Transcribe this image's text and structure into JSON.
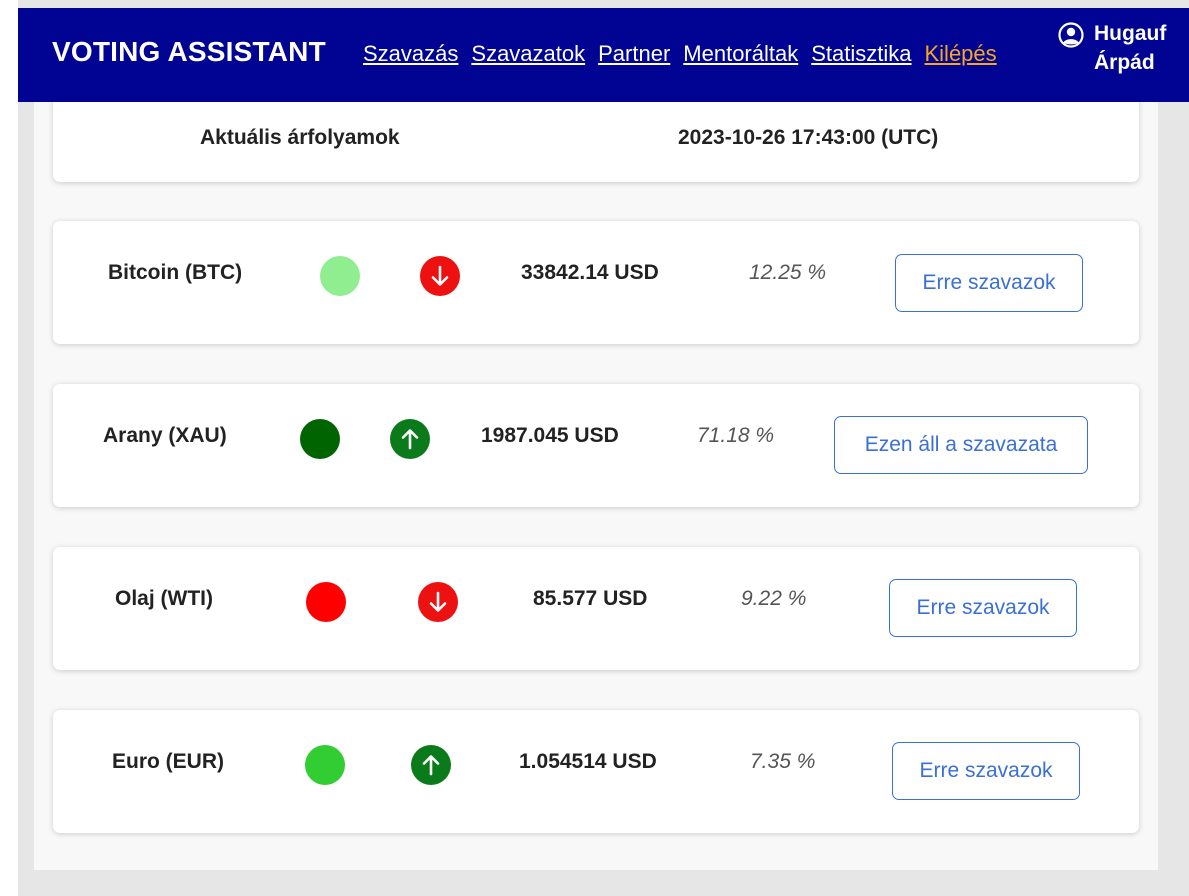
{
  "navbar": {
    "brand": "VOTING ASSISTANT",
    "links": [
      "Szavazás",
      "Szavazatok",
      "Partner",
      "Mentoráltak",
      "Statisztika",
      "Kilépés"
    ],
    "user": {
      "first": "Hugauf",
      "last": "Árpád",
      "icon": "user-circle-icon"
    },
    "colors": {
      "background": "#010493",
      "logout": "#f5a623"
    }
  },
  "rates_header": {
    "label": "Aktuális árfolyamok",
    "timestamp": "2023-10-26 17:43:00 (UTC)"
  },
  "assets": [
    {
      "name": "Bitcoin (BTC)",
      "status_color": "#90ee90",
      "trend": "down",
      "trend_icon": "arrow-down-icon",
      "trend_color": "#ee1111",
      "price": "33842.14 USD",
      "percent": "12.25 %",
      "button": "Erre szavazok"
    },
    {
      "name": "Arany (XAU)",
      "status_color": "#006400",
      "trend": "up",
      "trend_icon": "arrow-up-icon",
      "trend_color": "#0b7a1b",
      "price": "1987.045 USD",
      "percent": "71.18 %",
      "button": "Ezen áll a szavazata"
    },
    {
      "name": "Olaj (WTI)",
      "status_color": "#ff0000",
      "trend": "down",
      "trend_icon": "arrow-down-icon",
      "trend_color": "#ee1111",
      "price": "85.577 USD",
      "percent": "9.22 %",
      "button": "Erre szavazok"
    },
    {
      "name": "Euro (EUR)",
      "status_color": "#32cd32",
      "trend": "up",
      "trend_icon": "arrow-up-icon",
      "trend_color": "#0b7a1b",
      "price": "1.054514 USD",
      "percent": "7.35 %",
      "button": "Erre szavazok"
    }
  ]
}
